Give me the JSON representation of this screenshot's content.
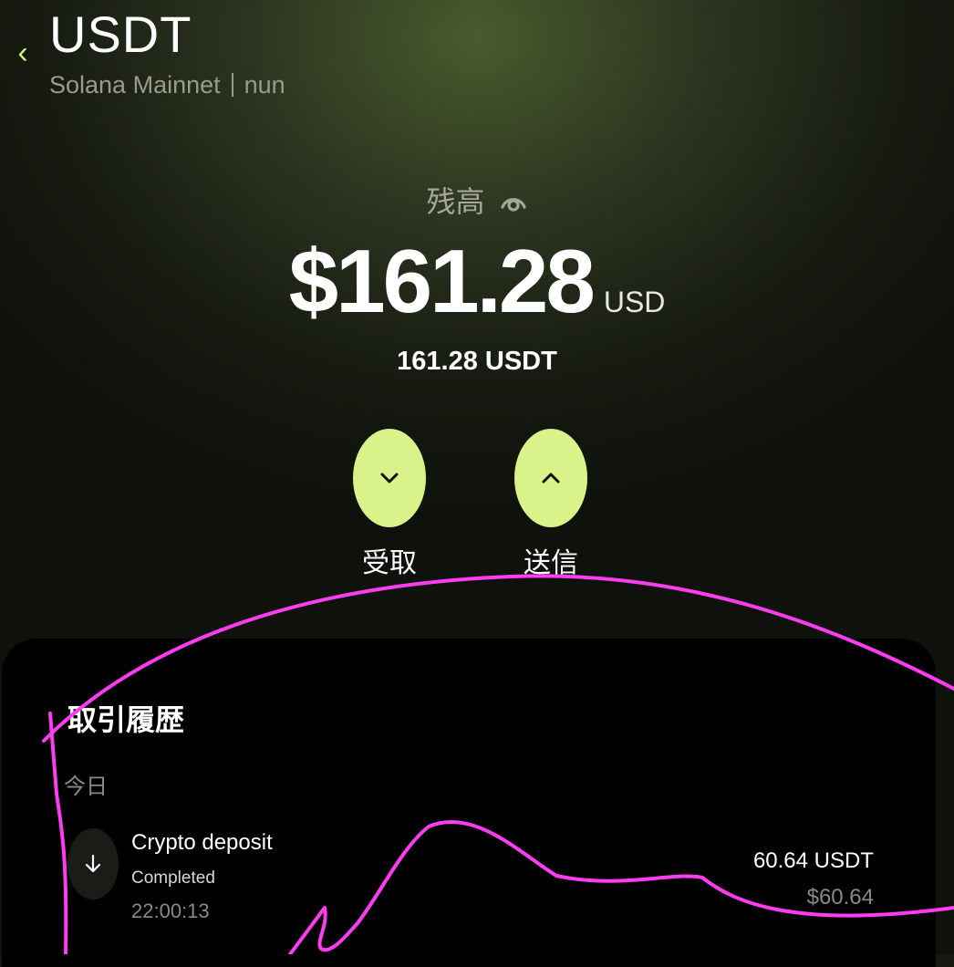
{
  "header": {
    "back_icon": "chevron-left-icon",
    "title": "USDT",
    "network": "Solana Mainnet",
    "account": "nun"
  },
  "balance": {
    "label": "残高",
    "eye_icon": "eye-icon",
    "amount": "$161.28",
    "currency": "USD",
    "token_amount": "161.28 USDT"
  },
  "actions": {
    "receive_label": "受取",
    "receive_icon": "chevron-down-icon",
    "send_label": "送信",
    "send_icon": "chevron-up-icon"
  },
  "history": {
    "title": "取引履歴",
    "groups": [
      {
        "day": "今日",
        "items": [
          {
            "icon": "arrow-down-icon",
            "name": "Crypto deposit",
            "status": "Completed",
            "time": "22:00:13",
            "amount": "60.64 USDT",
            "usd": "$60.64"
          }
        ]
      }
    ]
  },
  "colors": {
    "accent": "#d9f28a",
    "annotation": "#ff3df0"
  }
}
